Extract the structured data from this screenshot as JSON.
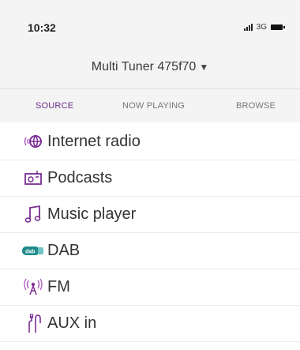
{
  "status_bar": {
    "time": "10:32",
    "network": "3G",
    "signal_icon": "signal-bars-icon",
    "battery_icon": "battery-icon"
  },
  "header": {
    "device_name": "Multi Tuner 475f70",
    "dropdown_caret": "▼"
  },
  "tabs": [
    {
      "label": "SOURCE",
      "active": true
    },
    {
      "label": "NOW PLAYING",
      "active": false
    },
    {
      "label": "BROWSE",
      "active": false
    }
  ],
  "sources": [
    {
      "label": "Internet radio",
      "icon": "internet-radio-icon"
    },
    {
      "label": "Podcasts",
      "icon": "podcast-radio-icon"
    },
    {
      "label": "Music player",
      "icon": "music-note-icon"
    },
    {
      "label": "DAB",
      "icon": "dab-icon"
    },
    {
      "label": "FM",
      "icon": "fm-antenna-icon"
    },
    {
      "label": "AUX in",
      "icon": "aux-plug-icon"
    }
  ],
  "colors": {
    "accent": "#6d2a8a",
    "header_bg": "#f4f4f4"
  }
}
